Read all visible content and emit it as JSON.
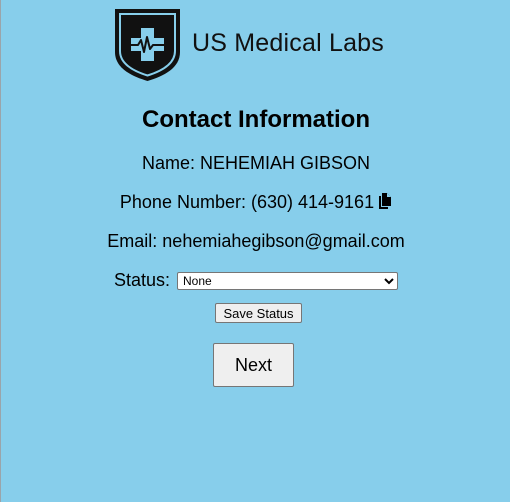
{
  "brand": {
    "name": "US Medical Labs",
    "logo_icon": "shield-medical-cross-icon"
  },
  "contact": {
    "heading": "Contact Information",
    "name_label": "Name: ",
    "name_value": "NEHEMIAH GIBSON",
    "phone_label": "Phone Number: ",
    "phone_value": "(630) 414-9161",
    "phone_copy_icon": "copy-icon",
    "email_label": "Email: ",
    "email_value": "nehemiahegibson@gmail.com"
  },
  "status": {
    "label": "Status: ",
    "selected": "None"
  },
  "buttons": {
    "save_status": "Save Status",
    "next": "Next"
  },
  "colors": {
    "page_background": "#87ceeb",
    "logo_shield": "#111111",
    "logo_accent": "#87ceeb"
  }
}
